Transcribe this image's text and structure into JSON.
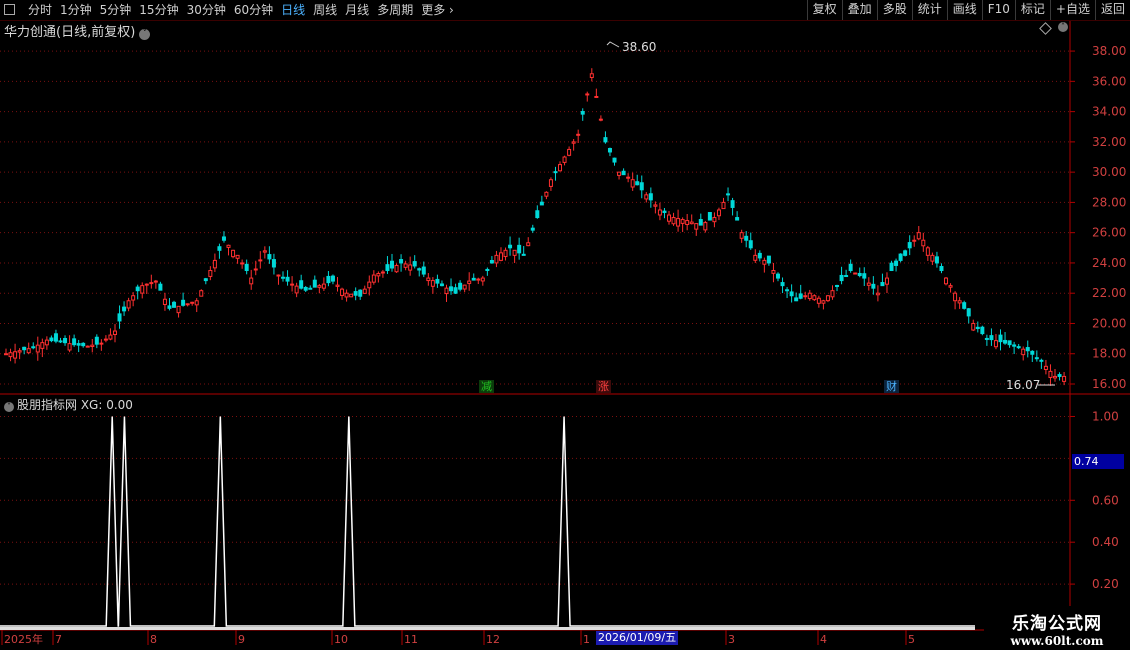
{
  "toolbar": {
    "tabs": [
      "分时",
      "1分钟",
      "5分钟",
      "15分钟",
      "30分钟",
      "60分钟",
      "日线",
      "周线",
      "月线",
      "多周期",
      "更多 ›"
    ],
    "active_tab": "日线",
    "right_buttons": [
      "复权",
      "叠加",
      "多股",
      "统计",
      "画线",
      "F10",
      "标记",
      "+自选",
      "返回"
    ]
  },
  "stock": {
    "title": "华力创通(日线,前复权)",
    "high_label": "38.60",
    "low_label": "16.07"
  },
  "price_axis": {
    "ticks": [
      "38.00",
      "36.00",
      "34.00",
      "32.00",
      "30.00",
      "28.00",
      "26.00",
      "24.00",
      "22.00",
      "20.00",
      "18.00",
      "16.00"
    ]
  },
  "indicator": {
    "title": "股朋指标网 XG: 0.00",
    "ticks": [
      "1.00",
      "0.60",
      "0.40",
      "0.20"
    ],
    "current_value": "0.74",
    "spike_positions": [
      0.11,
      0.122,
      0.216,
      0.342,
      0.553
    ]
  },
  "events": [
    {
      "label": "减",
      "color": "#22c022"
    },
    {
      "label": "涨",
      "color": "#ff4040"
    },
    {
      "label": "财",
      "color": "#4db3ff"
    }
  ],
  "time_axis": {
    "labels": [
      "2025年",
      "7",
      "8",
      "9",
      "10",
      "11",
      "12",
      "1",
      "3",
      "4",
      "5"
    ],
    "cursor_date": "2026/01/09/五"
  },
  "watermark": {
    "line1": "乐淘公式网",
    "line2": "www.60lt.com"
  },
  "chart_data": {
    "type": "candlestick",
    "price_range": [
      16.0,
      38.6
    ],
    "closes_approx": [
      18.0,
      18.2,
      18.4,
      18.9,
      18.8,
      18.6,
      18.5,
      18.7,
      19.5,
      21.5,
      22.5,
      22.8,
      21.0,
      21.2,
      21.5,
      23.5,
      25.5,
      24.5,
      23.0,
      24.8,
      23.2,
      22.6,
      22.2,
      22.5,
      22.8,
      22.0,
      21.8,
      23.2,
      23.5,
      24.0,
      23.8,
      23.0,
      22.5,
      22.0,
      22.8,
      23.0,
      24.5,
      25.0,
      24.5,
      27.0,
      29.5,
      31.0,
      32.5,
      36.5,
      32.0,
      30.0,
      29.5,
      28.5,
      27.5,
      27.0,
      26.8,
      26.5,
      27.0,
      28.5,
      26.0,
      24.5,
      24.0,
      22.5,
      21.5,
      22.0,
      21.5,
      22.5,
      23.5,
      23.0,
      22.0,
      23.5,
      24.5,
      26.0,
      24.5,
      23.0,
      21.5,
      20.0,
      19.0,
      18.8,
      18.5,
      18.2,
      17.5,
      16.5
    ]
  }
}
